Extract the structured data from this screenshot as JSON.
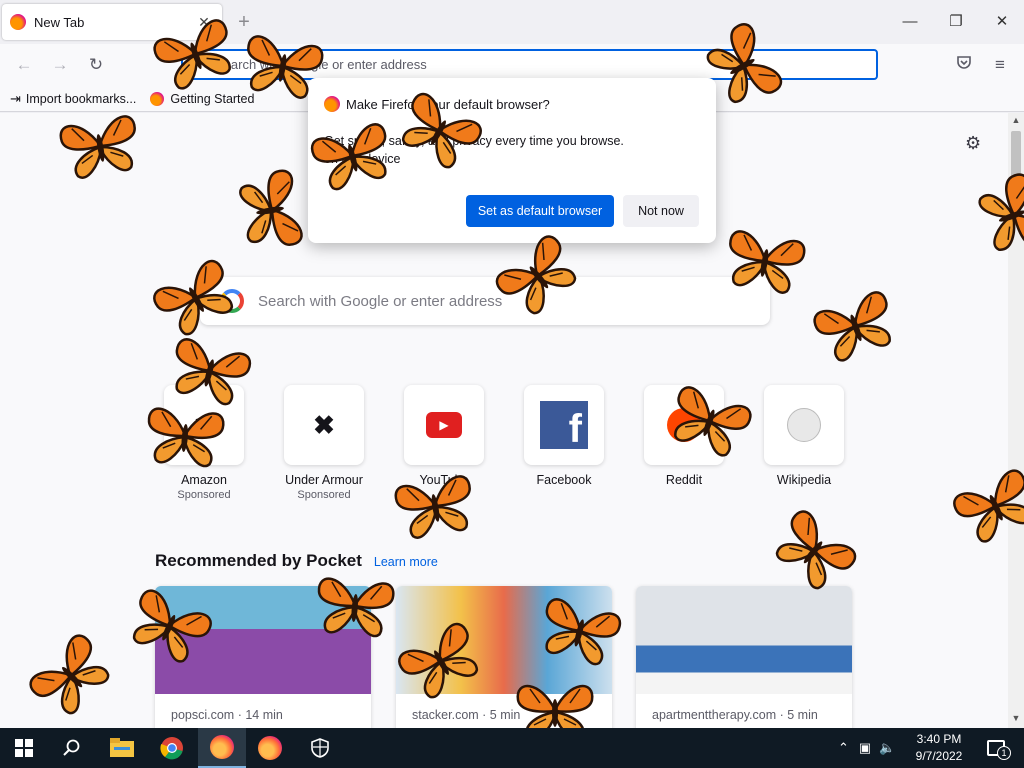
{
  "window": {
    "tab_title": "New Tab",
    "tab_close": "✕",
    "new_tab": "+",
    "minimize": "—",
    "restore": "❐",
    "close": "✕"
  },
  "navbar": {
    "back": "←",
    "forward": "→",
    "reload": "↻",
    "url_placeholder": "Search with Google or enter address",
    "pocket_icon": "pocket-icon",
    "menu_icon": "≡"
  },
  "bookmarks": {
    "items": [
      {
        "label": "Import bookmarks...",
        "icon": "import-icon"
      },
      {
        "label": "Getting Started",
        "icon": "firefox-icon"
      }
    ]
  },
  "newtab": {
    "search_placeholder": "Search with Google or enter address",
    "top_sites": [
      {
        "name": "Amazon",
        "sub": "Sponsored",
        "icon": "amazon-icon"
      },
      {
        "name": "Under Armour",
        "sub": "Sponsored",
        "icon": "under-armour-icon"
      },
      {
        "name": "YouTube",
        "sub": "",
        "icon": "youtube-icon"
      },
      {
        "name": "Facebook",
        "sub": "",
        "icon": "facebook-icon"
      },
      {
        "name": "Reddit",
        "sub": "",
        "icon": "reddit-icon"
      },
      {
        "name": "Wikipedia",
        "sub": "",
        "icon": "wikipedia-icon"
      }
    ],
    "pocket_heading": "Recommended by Pocket",
    "pocket_learn_more": "Learn more",
    "cards": [
      {
        "source": "popsci.com · 14 min"
      },
      {
        "source": "stacker.com · 5 min"
      },
      {
        "source": "apartmenttherapy.com · 5 min"
      }
    ]
  },
  "popup": {
    "title": "Make Firefox your default browser?",
    "body": "Get speed, safety, and privacy every time you browse.",
    "body2": "on this device",
    "primary": "Set as default browser",
    "secondary": "Not now"
  },
  "taskbar": {
    "time": "3:40 PM",
    "date": "9/7/2022",
    "notification_count": "1"
  },
  "colors": {
    "accent": "#0061e0",
    "butterfly_wing": "#f07a1a",
    "taskbar": "#0f1a24"
  }
}
